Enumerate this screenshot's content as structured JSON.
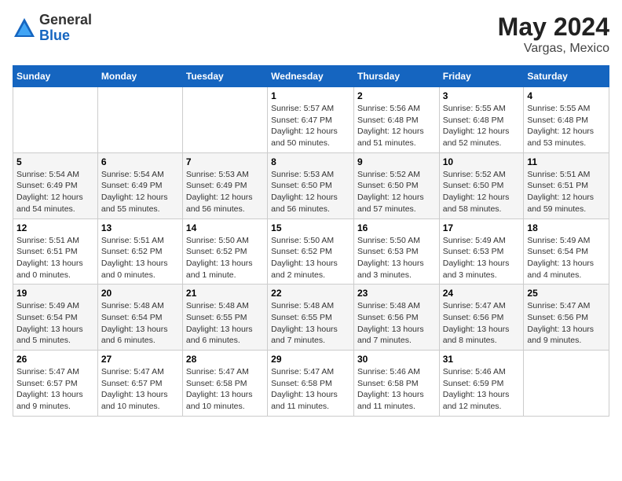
{
  "logo": {
    "general": "General",
    "blue": "Blue"
  },
  "title": {
    "month_year": "May 2024",
    "location": "Vargas, Mexico"
  },
  "days_of_week": [
    "Sunday",
    "Monday",
    "Tuesday",
    "Wednesday",
    "Thursday",
    "Friday",
    "Saturday"
  ],
  "weeks": [
    [
      {
        "day": "",
        "info": ""
      },
      {
        "day": "",
        "info": ""
      },
      {
        "day": "",
        "info": ""
      },
      {
        "day": "1",
        "info": "Sunrise: 5:57 AM\nSunset: 6:47 PM\nDaylight: 12 hours\nand 50 minutes."
      },
      {
        "day": "2",
        "info": "Sunrise: 5:56 AM\nSunset: 6:48 PM\nDaylight: 12 hours\nand 51 minutes."
      },
      {
        "day": "3",
        "info": "Sunrise: 5:55 AM\nSunset: 6:48 PM\nDaylight: 12 hours\nand 52 minutes."
      },
      {
        "day": "4",
        "info": "Sunrise: 5:55 AM\nSunset: 6:48 PM\nDaylight: 12 hours\nand 53 minutes."
      }
    ],
    [
      {
        "day": "5",
        "info": "Sunrise: 5:54 AM\nSunset: 6:49 PM\nDaylight: 12 hours\nand 54 minutes."
      },
      {
        "day": "6",
        "info": "Sunrise: 5:54 AM\nSunset: 6:49 PM\nDaylight: 12 hours\nand 55 minutes."
      },
      {
        "day": "7",
        "info": "Sunrise: 5:53 AM\nSunset: 6:49 PM\nDaylight: 12 hours\nand 56 minutes."
      },
      {
        "day": "8",
        "info": "Sunrise: 5:53 AM\nSunset: 6:50 PM\nDaylight: 12 hours\nand 56 minutes."
      },
      {
        "day": "9",
        "info": "Sunrise: 5:52 AM\nSunset: 6:50 PM\nDaylight: 12 hours\nand 57 minutes."
      },
      {
        "day": "10",
        "info": "Sunrise: 5:52 AM\nSunset: 6:50 PM\nDaylight: 12 hours\nand 58 minutes."
      },
      {
        "day": "11",
        "info": "Sunrise: 5:51 AM\nSunset: 6:51 PM\nDaylight: 12 hours\nand 59 minutes."
      }
    ],
    [
      {
        "day": "12",
        "info": "Sunrise: 5:51 AM\nSunset: 6:51 PM\nDaylight: 13 hours\nand 0 minutes."
      },
      {
        "day": "13",
        "info": "Sunrise: 5:51 AM\nSunset: 6:52 PM\nDaylight: 13 hours\nand 0 minutes."
      },
      {
        "day": "14",
        "info": "Sunrise: 5:50 AM\nSunset: 6:52 PM\nDaylight: 13 hours\nand 1 minute."
      },
      {
        "day": "15",
        "info": "Sunrise: 5:50 AM\nSunset: 6:52 PM\nDaylight: 13 hours\nand 2 minutes."
      },
      {
        "day": "16",
        "info": "Sunrise: 5:50 AM\nSunset: 6:53 PM\nDaylight: 13 hours\nand 3 minutes."
      },
      {
        "day": "17",
        "info": "Sunrise: 5:49 AM\nSunset: 6:53 PM\nDaylight: 13 hours\nand 3 minutes."
      },
      {
        "day": "18",
        "info": "Sunrise: 5:49 AM\nSunset: 6:54 PM\nDaylight: 13 hours\nand 4 minutes."
      }
    ],
    [
      {
        "day": "19",
        "info": "Sunrise: 5:49 AM\nSunset: 6:54 PM\nDaylight: 13 hours\nand 5 minutes."
      },
      {
        "day": "20",
        "info": "Sunrise: 5:48 AM\nSunset: 6:54 PM\nDaylight: 13 hours\nand 6 minutes."
      },
      {
        "day": "21",
        "info": "Sunrise: 5:48 AM\nSunset: 6:55 PM\nDaylight: 13 hours\nand 6 minutes."
      },
      {
        "day": "22",
        "info": "Sunrise: 5:48 AM\nSunset: 6:55 PM\nDaylight: 13 hours\nand 7 minutes."
      },
      {
        "day": "23",
        "info": "Sunrise: 5:48 AM\nSunset: 6:56 PM\nDaylight: 13 hours\nand 7 minutes."
      },
      {
        "day": "24",
        "info": "Sunrise: 5:47 AM\nSunset: 6:56 PM\nDaylight: 13 hours\nand 8 minutes."
      },
      {
        "day": "25",
        "info": "Sunrise: 5:47 AM\nSunset: 6:56 PM\nDaylight: 13 hours\nand 9 minutes."
      }
    ],
    [
      {
        "day": "26",
        "info": "Sunrise: 5:47 AM\nSunset: 6:57 PM\nDaylight: 13 hours\nand 9 minutes."
      },
      {
        "day": "27",
        "info": "Sunrise: 5:47 AM\nSunset: 6:57 PM\nDaylight: 13 hours\nand 10 minutes."
      },
      {
        "day": "28",
        "info": "Sunrise: 5:47 AM\nSunset: 6:58 PM\nDaylight: 13 hours\nand 10 minutes."
      },
      {
        "day": "29",
        "info": "Sunrise: 5:47 AM\nSunset: 6:58 PM\nDaylight: 13 hours\nand 11 minutes."
      },
      {
        "day": "30",
        "info": "Sunrise: 5:46 AM\nSunset: 6:58 PM\nDaylight: 13 hours\nand 11 minutes."
      },
      {
        "day": "31",
        "info": "Sunrise: 5:46 AM\nSunset: 6:59 PM\nDaylight: 13 hours\nand 12 minutes."
      },
      {
        "day": "",
        "info": ""
      }
    ]
  ]
}
